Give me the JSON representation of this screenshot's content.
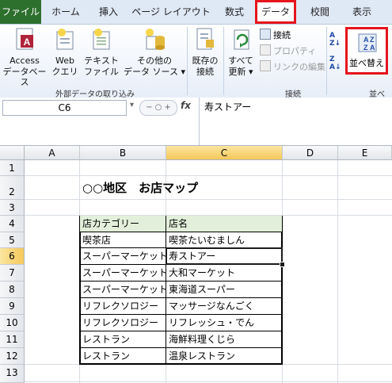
{
  "tabs": [
    "ファイル",
    "ホーム",
    "挿入",
    "ページ レイアウト",
    "数式",
    "データ",
    "校閲",
    "表示"
  ],
  "ribbon": {
    "access": [
      "Access",
      "データベース"
    ],
    "web": [
      "Web",
      "クエリ"
    ],
    "text": [
      "テキスト",
      "ファイル"
    ],
    "other": [
      "その他の",
      "データ ソース"
    ],
    "existing": [
      "既存の",
      "接続"
    ],
    "refresh": [
      "すべて",
      "更新"
    ],
    "conn": "接続",
    "props": "プロパティ",
    "links": "リンクの編集",
    "sort": "並べ替え",
    "group_ext": "外部データの取り込み",
    "group_conn": "接続",
    "group_sort": "並べ"
  },
  "formula_bar": {
    "name_box": "C6",
    "fx": "fx",
    "content": "寿ストアー"
  },
  "columns": [
    "A",
    "B",
    "C",
    "D",
    "E"
  ],
  "rows": [
    "1",
    "2",
    "3",
    "4",
    "5",
    "6",
    "7",
    "8",
    "9",
    "10",
    "11",
    "12",
    "13"
  ],
  "sheet": {
    "title": "○○地区　お店マップ",
    "headers": [
      "店カテゴリー",
      "店名"
    ],
    "table": [
      [
        "喫茶店",
        "喫茶たいむましん"
      ],
      [
        "スーパーマーケット",
        "寿ストアー"
      ],
      [
        "スーパーマーケット",
        "大和マーケット"
      ],
      [
        "スーパーマーケット",
        "東海道スーパー"
      ],
      [
        "リフレクソロジー",
        "マッサージなんごく"
      ],
      [
        "リフレクソロジー",
        "リフレッシュ・でん"
      ],
      [
        "レストラン",
        "海鮮料理くじら"
      ],
      [
        "レストラン",
        "温泉レストラン"
      ]
    ]
  },
  "colors": {
    "file_tab": "#2d6f2d",
    "highlight": "#e5141d",
    "header_fill": "#e2efda",
    "selected_header": "#f5c85a"
  }
}
